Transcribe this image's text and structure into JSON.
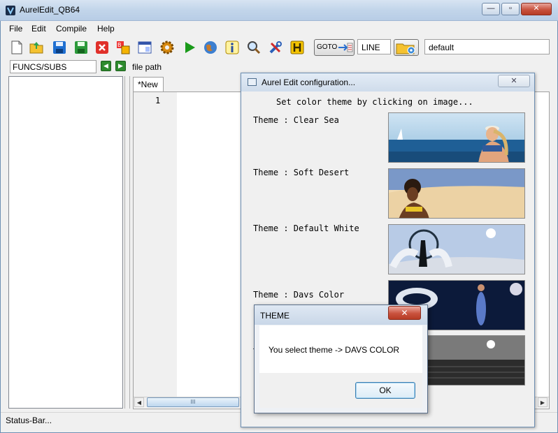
{
  "window": {
    "title": "AurelEdit_QB64",
    "min_glyph": "—",
    "max_glyph": "▫",
    "close_glyph": "✕"
  },
  "menu": {
    "items": [
      "File",
      "Edit",
      "Compile",
      "Help"
    ]
  },
  "toolbar": {
    "icons": [
      "new-file-icon",
      "open-folder-icon",
      "save-icon",
      "save-as-icon",
      "close-file-icon",
      "convert-icon",
      "window-icon",
      "gear-icon",
      "run-icon",
      "web-globe-icon",
      "info-icon",
      "search-icon",
      "tools-icon",
      "help-h-icon"
    ],
    "goto_label": "GOTO",
    "line_value": "LINE",
    "theme_value": "default"
  },
  "secondary": {
    "funcs_label": "FUNCS/SUBS",
    "back_glyph": "◀",
    "forward_glyph": "▶",
    "file_path": "file path"
  },
  "editor": {
    "tab_label": "*New",
    "line_number": "1",
    "hscroll_grip": "III",
    "left_arrow": "◀",
    "right_arrow": "▶"
  },
  "status": {
    "text": "Status-Bar..."
  },
  "config_dialog": {
    "title": "Aurel Edit configuration...",
    "close_glyph": "✕",
    "instruction": "Set color theme by clicking on image...",
    "themes": [
      {
        "label": "Theme : Clear Sea"
      },
      {
        "label": "Theme : Soft Desert"
      },
      {
        "label": "Theme : Default White"
      },
      {
        "label": "Theme : Davs Color"
      },
      {
        "label": "T"
      }
    ]
  },
  "theme_dialog": {
    "title": "THEME",
    "close_glyph": "✕",
    "message": "You select theme -> DAVS COLOR",
    "ok_label": "OK"
  }
}
